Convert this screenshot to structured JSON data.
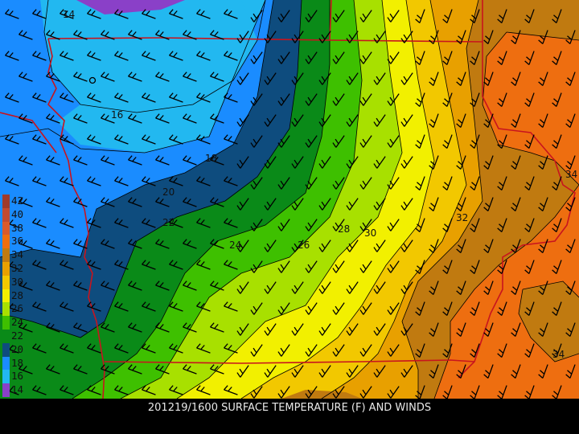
{
  "caption": "201219/1600 SURFACE TEMPERATURE (F) AND WINDS",
  "legend": [
    {
      "value": "42",
      "color": "#a03a2a"
    },
    {
      "value": "40",
      "color": "#c24a30"
    },
    {
      "value": "38",
      "color": "#d95a2c"
    },
    {
      "value": "36",
      "color": "#ee6e10"
    },
    {
      "value": "34",
      "color": "#c07a10"
    },
    {
      "value": "32",
      "color": "#e8a000"
    },
    {
      "value": "30",
      "color": "#f2c800"
    },
    {
      "value": "28",
      "color": "#f2f000"
    },
    {
      "value": "26",
      "color": "#a8e000"
    },
    {
      "value": "24",
      "color": "#3ec000"
    },
    {
      "value": "22",
      "color": "#0a8a18"
    },
    {
      "value": "20",
      "color": "#0e4c7e"
    },
    {
      "value": "18",
      "color": "#1a8cff"
    },
    {
      "value": "16",
      "color": "#22b8f0"
    },
    {
      "value": "14",
      "color": "#8a40c8"
    }
  ],
  "contour_labels": [
    {
      "text": "14",
      "zone": "northwest"
    },
    {
      "text": "16",
      "zone": "northwest"
    },
    {
      "text": "18",
      "zone": "west"
    },
    {
      "text": "20",
      "zone": "west"
    },
    {
      "text": "22",
      "zone": "west"
    },
    {
      "text": "24",
      "zone": "central"
    },
    {
      "text": "26",
      "zone": "central"
    },
    {
      "text": "28",
      "zone": "central"
    },
    {
      "text": "30",
      "zone": "central"
    },
    {
      "text": "32",
      "zone": "east"
    },
    {
      "text": "34",
      "zone": "east"
    },
    {
      "text": "34",
      "zone": "southeast"
    }
  ],
  "colors": {
    "boundary": "#c8141e",
    "contour": "#000000",
    "barb": "#000000",
    "background": "#000000"
  }
}
